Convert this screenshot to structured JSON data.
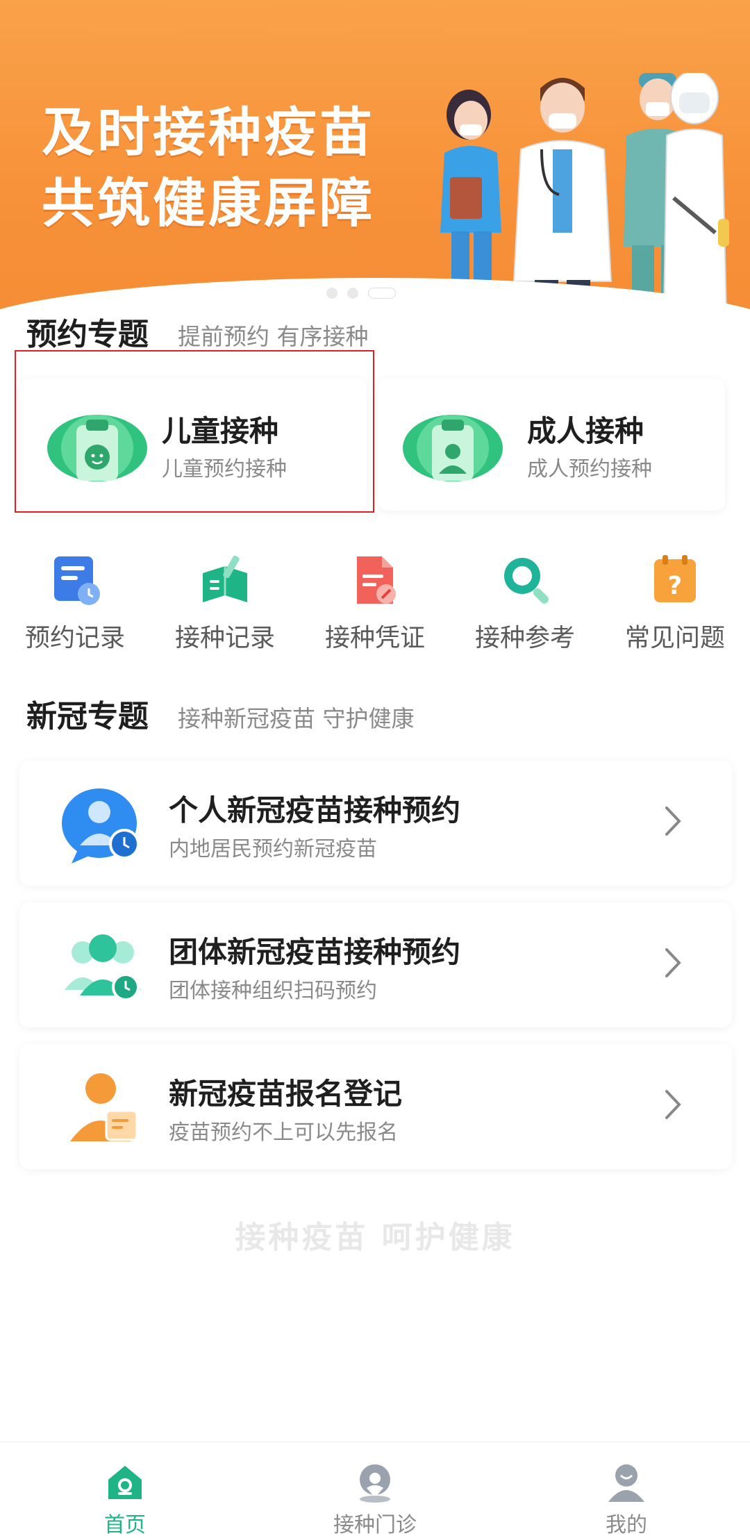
{
  "banner": {
    "line1": "及时接种疫苗",
    "line2": "共筑健康屏障",
    "slide_count": 3,
    "active_slide": 3
  },
  "booking": {
    "title": "预约专题",
    "subtitle": "提前预约 有序接种",
    "cards": [
      {
        "title": "儿童接种",
        "sub": "儿童预约接种",
        "icon": "child-clipboard-icon"
      },
      {
        "title": "成人接种",
        "sub": "成人预约接种",
        "icon": "adult-clipboard-icon"
      }
    ]
  },
  "quick_menu": [
    {
      "label": "预约记录",
      "icon": "appointment-record-icon"
    },
    {
      "label": "接种记录",
      "icon": "vaccination-record-icon"
    },
    {
      "label": "接种凭证",
      "icon": "vaccination-certificate-icon"
    },
    {
      "label": "接种参考",
      "icon": "search-reference-icon"
    },
    {
      "label": "常见问题",
      "icon": "faq-icon"
    }
  ],
  "covid": {
    "title": "新冠专题",
    "subtitle": "接种新冠疫苗 守护健康",
    "items": [
      {
        "title": "个人新冠疫苗接种预约",
        "sub": "内地居民预约新冠疫苗",
        "icon": "person-clock-icon"
      },
      {
        "title": "团体新冠疫苗接种预约",
        "sub": "团体接种组织扫码预约",
        "icon": "group-clock-icon"
      },
      {
        "title": "新冠疫苗报名登记",
        "sub": "疫苗预约不上可以先报名",
        "icon": "register-form-icon"
      }
    ]
  },
  "slogan": "接种疫苗  呵护健康",
  "tabbar": [
    {
      "label": "首页",
      "icon": "home-icon",
      "active": true
    },
    {
      "label": "接种门诊",
      "icon": "clinic-location-icon",
      "active": false
    },
    {
      "label": "我的",
      "icon": "profile-icon",
      "active": false
    }
  ],
  "colors": {
    "accent": "#1fb486",
    "banner": "#f7923a",
    "highlight": "#e02020"
  }
}
